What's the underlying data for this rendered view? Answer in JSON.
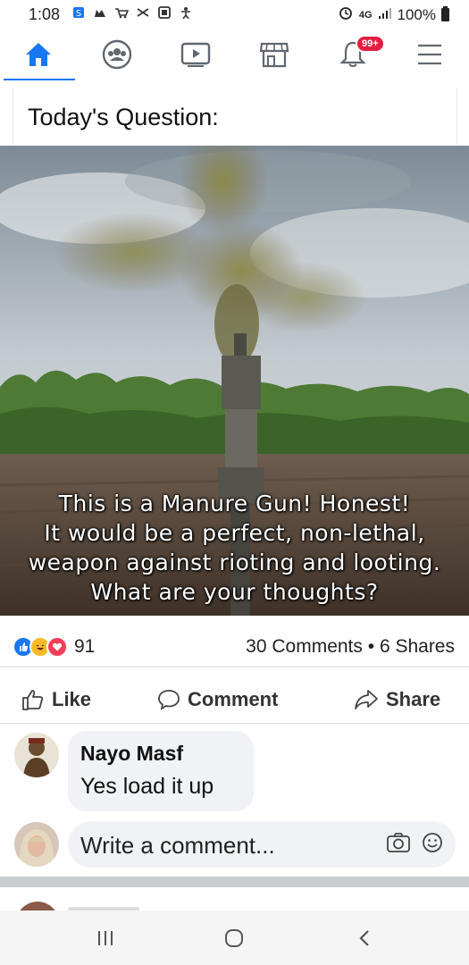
{
  "status_bar": {
    "time": "1:08",
    "battery_text": "100%",
    "network": "4G",
    "left_icons": [
      "s-icon",
      "cat-icon",
      "cart-icon",
      "squiggle-icon",
      "square-icon",
      "person-icon"
    ]
  },
  "nav": {
    "items": [
      {
        "name": "home",
        "icon": "home-icon",
        "active": true
      },
      {
        "name": "groups",
        "icon": "groups-icon"
      },
      {
        "name": "watch",
        "icon": "video-icon"
      },
      {
        "name": "marketplace",
        "icon": "store-icon"
      },
      {
        "name": "notifications",
        "icon": "bell-icon",
        "badge": "99+"
      },
      {
        "name": "menu",
        "icon": "menu-icon"
      }
    ],
    "accent_color": "#1877f2"
  },
  "post": {
    "title": "Today's Question:",
    "caption_lines": [
      "This is a Manure Gun! Honest!",
      "It would be a perfect, non-lethal,",
      "weapon against rioting and looting.",
      "What are your thoughts?"
    ],
    "reaction_count": "91",
    "reactions": [
      "like",
      "haha",
      "love"
    ],
    "comments_count": "30 Comments",
    "shares_count": "6 Shares",
    "separator": "•",
    "actions": {
      "like": "Like",
      "comment": "Comment",
      "share": "Share"
    }
  },
  "comments": [
    {
      "author": "Nayo Masf",
      "text": "Yes load it up"
    }
  ],
  "write_comment": {
    "placeholder": "Write a comment..."
  }
}
